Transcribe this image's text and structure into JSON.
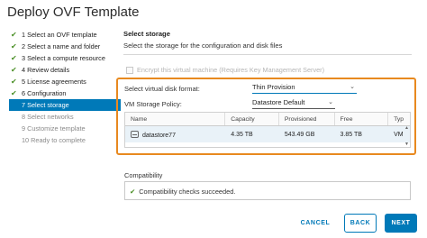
{
  "window": {
    "title": "Deploy OVF Template"
  },
  "steps": [
    {
      "label": "1 Select an OVF template",
      "done": true
    },
    {
      "label": "2 Select a name and folder",
      "done": true
    },
    {
      "label": "3 Select a compute resource",
      "done": true
    },
    {
      "label": "4 Review details",
      "done": true
    },
    {
      "label": "5 License agreements",
      "done": true
    },
    {
      "label": "6 Configuration",
      "done": true
    },
    {
      "label": "7 Select storage",
      "current": true
    },
    {
      "label": "8 Select networks"
    },
    {
      "label": "9 Customize template"
    },
    {
      "label": "10 Ready to complete"
    }
  ],
  "main": {
    "title": "Select storage",
    "description": "Select the storage for the configuration and disk files",
    "encrypt_label": "Encrypt this virtual machine (Requires Key Management Server)",
    "disk_format": {
      "label": "Select virtual disk format:",
      "value": "Thin Provision"
    },
    "storage_policy": {
      "label": "VM Storage Policy:",
      "value": "Datastore Default"
    },
    "table": {
      "columns": [
        "Name",
        "Capacity",
        "Provisioned",
        "Free",
        "Typ"
      ],
      "rows": [
        {
          "name": "datastore77",
          "capacity": "4.35 TB",
          "provisioned": "543.49 GB",
          "free": "3.85 TB",
          "type": "VM"
        }
      ]
    },
    "compatibility": {
      "label": "Compatibility",
      "message": "Compatibility checks succeeded."
    }
  },
  "buttons": {
    "cancel": "CANCEL",
    "back": "BACK",
    "next": "NEXT"
  },
  "colors": {
    "accent": "#0079b8",
    "highlight": "#e8891f",
    "success": "#4a8f26"
  }
}
